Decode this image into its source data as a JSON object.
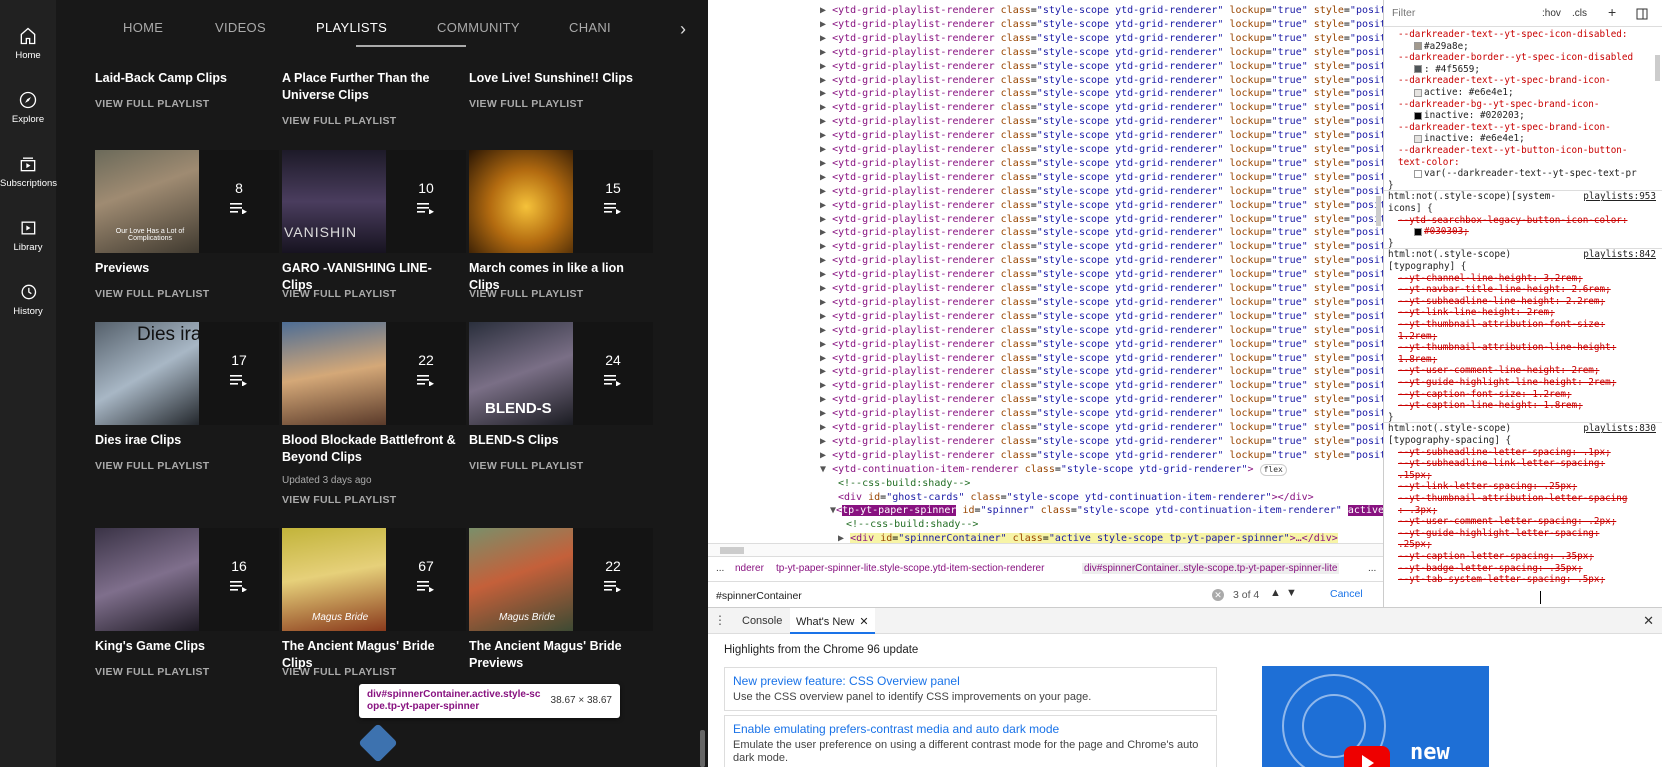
{
  "youtube": {
    "guide": [
      {
        "label": "Home",
        "icon": "home-icon"
      },
      {
        "label": "Explore",
        "icon": "compass-icon"
      },
      {
        "label": "Subscriptions",
        "icon": "subscriptions-icon"
      },
      {
        "label": "Library",
        "icon": "library-icon"
      },
      {
        "label": "History",
        "icon": "history-icon"
      }
    ],
    "tabs": [
      "HOME",
      "VIDEOS",
      "PLAYLISTS",
      "COMMUNITY",
      "CHANI"
    ],
    "selected_tab": "PLAYLISTS",
    "view_full": "VIEW FULL PLAYLIST",
    "playlists": [
      {
        "title": "Laid-Back Camp Clips",
        "count": "",
        "meta": ""
      },
      {
        "title": "A Place Further Than the Universe Clips",
        "count": "",
        "meta": ""
      },
      {
        "title": "Love Live! Sunshine!! Clips",
        "count": "",
        "meta": ""
      },
      {
        "title": "Previews",
        "count": "8",
        "meta": ""
      },
      {
        "title": "GARO -VANISHING LINE- Clips",
        "count": "10",
        "meta": ""
      },
      {
        "title": "March comes in like a lion Clips",
        "count": "15",
        "meta": ""
      },
      {
        "title": "Dies irae Clips",
        "count": "17",
        "meta": ""
      },
      {
        "title": "Blood Blockade Battlefront & Beyond Clips",
        "count": "22",
        "meta": "Updated 3 days ago"
      },
      {
        "title": "BLEND-S Clips",
        "count": "24",
        "meta": ""
      },
      {
        "title": "King's Game Clips",
        "count": "16",
        "meta": ""
      },
      {
        "title": "The Ancient Magus' Bride Clips",
        "count": "67",
        "meta": ""
      },
      {
        "title": "The Ancient Magus' Bride Previews",
        "count": "22",
        "meta": ""
      }
    ],
    "thumb_text": [
      "Our Love Has a Lot of Complications",
      "VANISHIN",
      "Dies irae",
      "BLEND-S",
      "Magus Bride",
      "Magus Bride"
    ],
    "tooltip": {
      "selector": "div#spinnerContainer.active.style-scope.tp-yt-paper-spinner",
      "size": "38.67 × 38.67"
    }
  },
  "devtools": {
    "elements": {
      "grid_line": {
        "tag": "ytd-grid-playlist-renderer",
        "class": "style-scope ytd-grid-renderer",
        "lockup": "true",
        "style": "positio"
      },
      "cont_line": {
        "tag": "ytd-continuation-item-renderer",
        "class": "style-scope ytd-grid-renderer",
        "badge": "flex"
      },
      "comment": "<!--css-build:shady-->",
      "ghost": {
        "id": "ghost-cards",
        "class": "style-scope ytd-continuation-item-renderer"
      },
      "spinner": {
        "tag": "tp-yt-paper-spinner",
        "id": "spinner",
        "class": "style-scope ytd-continuation-item-renderer",
        "attr": "active"
      },
      "container": {
        "id": "spinnerContainer",
        "class": "active  style-scope tp-yt-paper-spinner",
        "tail": ">…</div>"
      }
    },
    "breadcrumbs": [
      "...",
      "nderer",
      "tp-yt-paper-spinner-lite.style-scope.ytd-item-section-renderer",
      "div#spinnerContainer..style-scope.tp-yt-paper-spinner-lite",
      "..."
    ],
    "search": {
      "value": "#spinnerContainer",
      "match": "3 of 4",
      "cancel": "Cancel"
    },
    "styles": {
      "filter_placeholder": "Filter",
      "hov": ":hov",
      "cls": ".cls",
      "lines": [
        {
          "text": "--darkreader-text--yt-spec-icon-disabled:",
          "cls": "pn"
        },
        {
          "text": "#a29a8e;",
          "swatch": "#a29a8e"
        },
        {
          "text": "--darkreader-border--yt-spec-icon-disabled",
          "cls": "pn"
        },
        {
          "text": ": #4f5659;",
          "swatch": "#4f5659"
        },
        {
          "text": "--darkreader-text--yt-spec-brand-icon-",
          "cls": "pn"
        },
        {
          "text": "active: #e6e4e1;",
          "swatch": "#e6e4e1"
        },
        {
          "text": "--darkreader-bg--yt-spec-brand-icon-",
          "cls": "pn"
        },
        {
          "text": "inactive: #020203;",
          "swatch": "#020203"
        },
        {
          "text": "--darkreader-text--yt-spec-brand-icon-",
          "cls": "pn"
        },
        {
          "text": "inactive: #e6e4e1;",
          "swatch": "#e6e4e1"
        },
        {
          "text": "--darkreader-text--yt-button-icon-button-",
          "cls": "pn"
        },
        {
          "text": "text-color:",
          "cls": "pn"
        },
        {
          "text": "var(--darkreader-text--yt-spec-text-pr",
          "swatch": "#ffffff"
        },
        {
          "text": "}"
        },
        {
          "text": "html:not(.style-scope)[system-",
          "src": "playlists:953"
        },
        {
          "text": "icons] {"
        },
        {
          "text": "--ytd-searchbox-legacy-button-icon-color:",
          "strike": true
        },
        {
          "text": "#030303;",
          "strike": true,
          "swatch": "#030303"
        },
        {
          "text": "}"
        },
        {
          "text": "html:not(.style-scope)",
          "src": "playlists:842"
        },
        {
          "text": "[typography] {"
        },
        {
          "text": "--yt-channel-line-height: 3.2rem;",
          "strike": true
        },
        {
          "text": "--yt-navbar-title-line-height: 2.6rem;",
          "strike": true
        },
        {
          "text": "--yt-subheadline-line-height: 2.2rem;",
          "strike": true
        },
        {
          "text": "--yt-link-line-height: 2rem;",
          "strike": true
        },
        {
          "text": "--yt-thumbnail-attribution-font-size:",
          "strike": true
        },
        {
          "text": "1.2rem;",
          "strike": true
        },
        {
          "text": "--yt-thumbnail-attribution-line-height:",
          "strike": true
        },
        {
          "text": "1.8rem;",
          "strike": true
        },
        {
          "text": "--yt-user-comment-line-height: 2rem;",
          "strike": true
        },
        {
          "text": "--yt-guide-highlight-line-height: 2rem;",
          "strike": true
        },
        {
          "text": "--yt-caption-font-size: 1.2rem;",
          "strike": true
        },
        {
          "text": "--yt-caption-line-height: 1.8rem;",
          "strike": true
        },
        {
          "text": "}"
        },
        {
          "text": "html:not(.style-scope)",
          "src": "playlists:830"
        },
        {
          "text": "[typography-spacing] {"
        },
        {
          "text": "--yt-subheadline-letter-spacing: .1px;",
          "strike": true
        },
        {
          "text": "--yt-subheadline-link-letter-spacing:",
          "strike": true
        },
        {
          "text": ".15px;",
          "strike": true
        },
        {
          "text": "--yt-link-letter-spacing: .25px;",
          "strike": true
        },
        {
          "text": "--yt-thumbnail-attribution-letter-spacing",
          "strike": true
        },
        {
          "text": ": .3px;",
          "strike": true
        },
        {
          "text": "--yt-user-comment-letter-spacing: .2px;",
          "strike": true
        },
        {
          "text": "--yt-guide-highlight-letter-spacing:",
          "strike": true
        },
        {
          "text": ".25px;",
          "strike": true
        },
        {
          "text": "--yt-caption-letter-spacing: .35px;",
          "strike": true
        },
        {
          "text": "--yt-badge-letter-spacing: .35px;",
          "strike": true
        },
        {
          "text": "--yt-tab-system-letter-spacing: .5px;",
          "strike": true
        }
      ]
    },
    "drawer": {
      "tabs": [
        "Console",
        "What's New"
      ],
      "header": "Highlights from the Chrome 96 update",
      "cards": [
        {
          "title": "New preview feature: CSS Overview panel",
          "desc": "Use the CSS overview panel to identify CSS improvements on your page."
        },
        {
          "title": "Enable emulating prefers-contrast media and auto dark mode",
          "desc": "Emulate the user preference on using a different contrast mode for the page and Chrome's auto dark mode."
        }
      ],
      "promo_text": "new"
    }
  }
}
